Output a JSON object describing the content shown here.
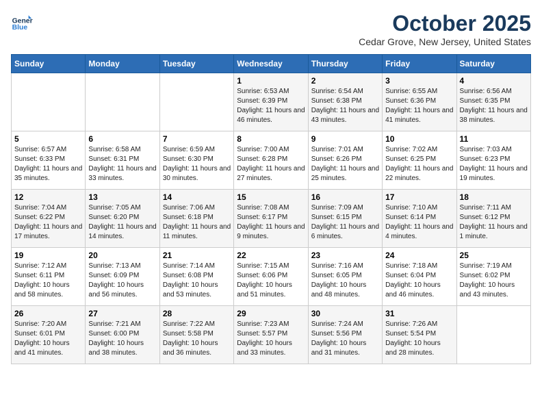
{
  "header": {
    "logo_line1": "General",
    "logo_line2": "Blue",
    "title": "October 2025",
    "subtitle": "Cedar Grove, New Jersey, United States"
  },
  "days_of_week": [
    "Sunday",
    "Monday",
    "Tuesday",
    "Wednesday",
    "Thursday",
    "Friday",
    "Saturday"
  ],
  "weeks": [
    [
      {
        "day": null,
        "content": null
      },
      {
        "day": null,
        "content": null
      },
      {
        "day": null,
        "content": null
      },
      {
        "day": "1",
        "content": "Sunrise: 6:53 AM\nSunset: 6:39 PM\nDaylight: 11 hours and 46 minutes."
      },
      {
        "day": "2",
        "content": "Sunrise: 6:54 AM\nSunset: 6:38 PM\nDaylight: 11 hours and 43 minutes."
      },
      {
        "day": "3",
        "content": "Sunrise: 6:55 AM\nSunset: 6:36 PM\nDaylight: 11 hours and 41 minutes."
      },
      {
        "day": "4",
        "content": "Sunrise: 6:56 AM\nSunset: 6:35 PM\nDaylight: 11 hours and 38 minutes."
      }
    ],
    [
      {
        "day": "5",
        "content": "Sunrise: 6:57 AM\nSunset: 6:33 PM\nDaylight: 11 hours and 35 minutes."
      },
      {
        "day": "6",
        "content": "Sunrise: 6:58 AM\nSunset: 6:31 PM\nDaylight: 11 hours and 33 minutes."
      },
      {
        "day": "7",
        "content": "Sunrise: 6:59 AM\nSunset: 6:30 PM\nDaylight: 11 hours and 30 minutes."
      },
      {
        "day": "8",
        "content": "Sunrise: 7:00 AM\nSunset: 6:28 PM\nDaylight: 11 hours and 27 minutes."
      },
      {
        "day": "9",
        "content": "Sunrise: 7:01 AM\nSunset: 6:26 PM\nDaylight: 11 hours and 25 minutes."
      },
      {
        "day": "10",
        "content": "Sunrise: 7:02 AM\nSunset: 6:25 PM\nDaylight: 11 hours and 22 minutes."
      },
      {
        "day": "11",
        "content": "Sunrise: 7:03 AM\nSunset: 6:23 PM\nDaylight: 11 hours and 19 minutes."
      }
    ],
    [
      {
        "day": "12",
        "content": "Sunrise: 7:04 AM\nSunset: 6:22 PM\nDaylight: 11 hours and 17 minutes."
      },
      {
        "day": "13",
        "content": "Sunrise: 7:05 AM\nSunset: 6:20 PM\nDaylight: 11 hours and 14 minutes."
      },
      {
        "day": "14",
        "content": "Sunrise: 7:06 AM\nSunset: 6:18 PM\nDaylight: 11 hours and 11 minutes."
      },
      {
        "day": "15",
        "content": "Sunrise: 7:08 AM\nSunset: 6:17 PM\nDaylight: 11 hours and 9 minutes."
      },
      {
        "day": "16",
        "content": "Sunrise: 7:09 AM\nSunset: 6:15 PM\nDaylight: 11 hours and 6 minutes."
      },
      {
        "day": "17",
        "content": "Sunrise: 7:10 AM\nSunset: 6:14 PM\nDaylight: 11 hours and 4 minutes."
      },
      {
        "day": "18",
        "content": "Sunrise: 7:11 AM\nSunset: 6:12 PM\nDaylight: 11 hours and 1 minute."
      }
    ],
    [
      {
        "day": "19",
        "content": "Sunrise: 7:12 AM\nSunset: 6:11 PM\nDaylight: 10 hours and 58 minutes."
      },
      {
        "day": "20",
        "content": "Sunrise: 7:13 AM\nSunset: 6:09 PM\nDaylight: 10 hours and 56 minutes."
      },
      {
        "day": "21",
        "content": "Sunrise: 7:14 AM\nSunset: 6:08 PM\nDaylight: 10 hours and 53 minutes."
      },
      {
        "day": "22",
        "content": "Sunrise: 7:15 AM\nSunset: 6:06 PM\nDaylight: 10 hours and 51 minutes."
      },
      {
        "day": "23",
        "content": "Sunrise: 7:16 AM\nSunset: 6:05 PM\nDaylight: 10 hours and 48 minutes."
      },
      {
        "day": "24",
        "content": "Sunrise: 7:18 AM\nSunset: 6:04 PM\nDaylight: 10 hours and 46 minutes."
      },
      {
        "day": "25",
        "content": "Sunrise: 7:19 AM\nSunset: 6:02 PM\nDaylight: 10 hours and 43 minutes."
      }
    ],
    [
      {
        "day": "26",
        "content": "Sunrise: 7:20 AM\nSunset: 6:01 PM\nDaylight: 10 hours and 41 minutes."
      },
      {
        "day": "27",
        "content": "Sunrise: 7:21 AM\nSunset: 6:00 PM\nDaylight: 10 hours and 38 minutes."
      },
      {
        "day": "28",
        "content": "Sunrise: 7:22 AM\nSunset: 5:58 PM\nDaylight: 10 hours and 36 minutes."
      },
      {
        "day": "29",
        "content": "Sunrise: 7:23 AM\nSunset: 5:57 PM\nDaylight: 10 hours and 33 minutes."
      },
      {
        "day": "30",
        "content": "Sunrise: 7:24 AM\nSunset: 5:56 PM\nDaylight: 10 hours and 31 minutes."
      },
      {
        "day": "31",
        "content": "Sunrise: 7:26 AM\nSunset: 5:54 PM\nDaylight: 10 hours and 28 minutes."
      },
      {
        "day": null,
        "content": null
      }
    ]
  ]
}
